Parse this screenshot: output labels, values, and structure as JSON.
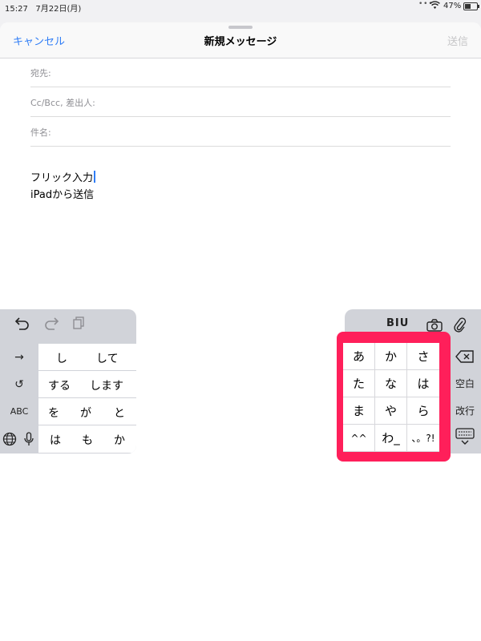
{
  "status_bar": {
    "time": "15:27",
    "date": "7月22日(月)",
    "battery": "47%",
    "battery_fraction": 0.47
  },
  "nav": {
    "cancel": "キャンセル",
    "title": "新規メッセージ",
    "send": "送信"
  },
  "fields": {
    "to": "宛先:",
    "cc_bcc_from": "Cc/Bcc, 差出人:",
    "subject": "件名:"
  },
  "body": {
    "line1": "フリック入力",
    "line2": "iPadから送信"
  },
  "left_keyboard": {
    "function_keys": [
      "→",
      "↺",
      "ABC"
    ],
    "suggestions": [
      [
        "し",
        "して"
      ],
      [
        "する",
        "します"
      ],
      [
        "を",
        "が",
        "と"
      ],
      [
        "は",
        "も",
        "か"
      ]
    ]
  },
  "right_keyboard": {
    "format_label": "BIU",
    "side_keys": {
      "space": "空白",
      "return": "改行"
    },
    "kana_keys": [
      "あ",
      "か",
      "さ",
      "た",
      "な",
      "は",
      "ま",
      "や",
      "ら",
      "^^",
      "わ_",
      "、。?!"
    ]
  },
  "colors": {
    "accent": "#2f7df6",
    "highlight": "#ff1f5a",
    "keyboard_bg": "#d1d3d9"
  }
}
